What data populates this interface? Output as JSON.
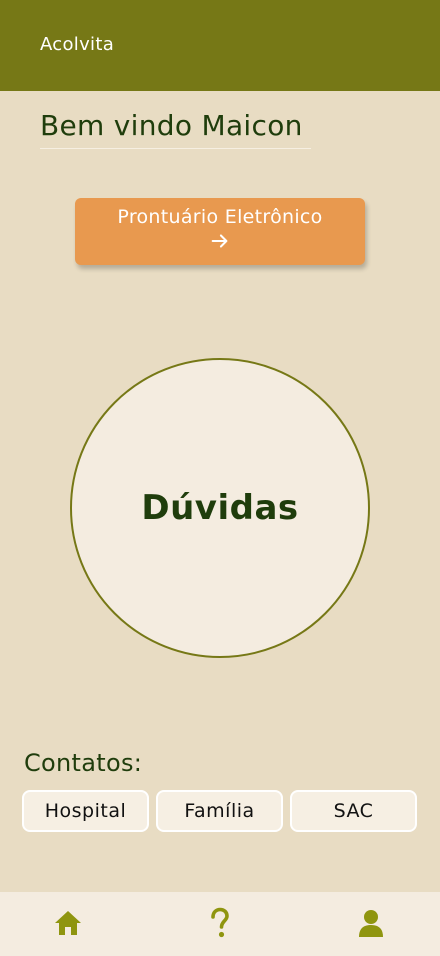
{
  "header": {
    "title": "Acolvita"
  },
  "welcome": {
    "text": "Bem vindo Maicon"
  },
  "records_button": {
    "label": "Prontuário Eletrônico",
    "icon": "arrow-right-icon"
  },
  "doubts": {
    "label": "Dúvidas"
  },
  "contacts": {
    "title": "Contatos:",
    "buttons": [
      "Hospital",
      "Família",
      "SAC"
    ]
  },
  "bottom_nav": {
    "items": [
      {
        "icon": "home-icon"
      },
      {
        "icon": "question-icon"
      },
      {
        "icon": "user-icon"
      }
    ]
  },
  "colors": {
    "header": "#767816",
    "background": "#e8dcc3",
    "accent": "#e8994f",
    "text_dark": "#1f3d0c",
    "nav_icon": "#8f950f"
  }
}
